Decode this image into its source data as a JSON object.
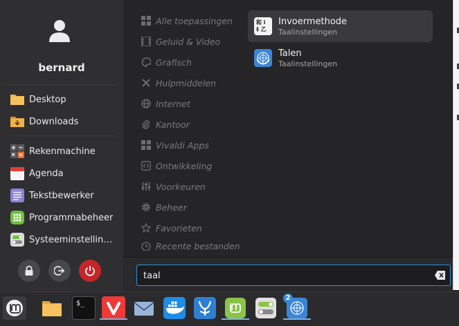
{
  "user": {
    "name": "bernard"
  },
  "favorites": [
    {
      "label": "Desktop",
      "icon": "folder-icon"
    },
    {
      "label": "Downloads",
      "icon": "downloads-folder-icon"
    },
    {
      "label": "Rekenmachine",
      "icon": "calculator-icon"
    },
    {
      "label": "Agenda",
      "icon": "calendar-icon"
    },
    {
      "label": "Tekstbewerker",
      "icon": "text-editor-icon"
    },
    {
      "label": "Programmabeheer",
      "icon": "software-manager-icon"
    },
    {
      "label": "Systeeminstellingen",
      "icon": "system-settings-icon"
    }
  ],
  "session_buttons": {
    "lock": "lock-icon",
    "logout": "logout-icon",
    "power": "power-icon"
  },
  "categories": [
    {
      "label": "Alle toepassingen",
      "icon": "grid-icon"
    },
    {
      "label": "Geluid & Video",
      "icon": "film-icon"
    },
    {
      "label": "Grafisch",
      "icon": "palette-icon"
    },
    {
      "label": "Hulpmiddelen",
      "icon": "tools-icon"
    },
    {
      "label": "Internet",
      "icon": "globe-icon"
    },
    {
      "label": "Kantoor",
      "icon": "paperclip-icon"
    },
    {
      "label": "Vivaldi Apps",
      "icon": "grid-icon"
    },
    {
      "label": "Ontwikkeling",
      "icon": "code-icon"
    },
    {
      "label": "Voorkeuren",
      "icon": "sliders-icon"
    },
    {
      "label": "Beheer",
      "icon": "gear-icon"
    },
    {
      "label": "Favorieten",
      "icon": "star-icon"
    },
    {
      "label": "Recente bestanden",
      "icon": "clock-icon"
    }
  ],
  "results": [
    {
      "name": "Invoermethode",
      "subtitle": "Taalinstellingen",
      "icon": "input-method-icon",
      "icon_text": "和 i\n‡ 乙"
    },
    {
      "name": "Talen",
      "subtitle": "Taalinstellingen",
      "icon": "un-languages-icon"
    }
  ],
  "search": {
    "value": "taal"
  },
  "taskbar": {
    "items": [
      {
        "name": "mint-menu-icon"
      },
      {
        "name": "files-icon"
      },
      {
        "name": "terminal-icon",
        "text": "$_"
      },
      {
        "name": "vivaldi-icon"
      },
      {
        "name": "mail-icon"
      },
      {
        "name": "docker-icon"
      },
      {
        "name": "vscodium-icon"
      },
      {
        "name": "mintinstall-icon"
      },
      {
        "name": "settings-toggle-icon"
      },
      {
        "name": "languages-icon",
        "badge": "2"
      }
    ]
  },
  "colors": {
    "accent": "#2f8fd8",
    "power": "#c5262a",
    "mint": "#8bc34a"
  }
}
